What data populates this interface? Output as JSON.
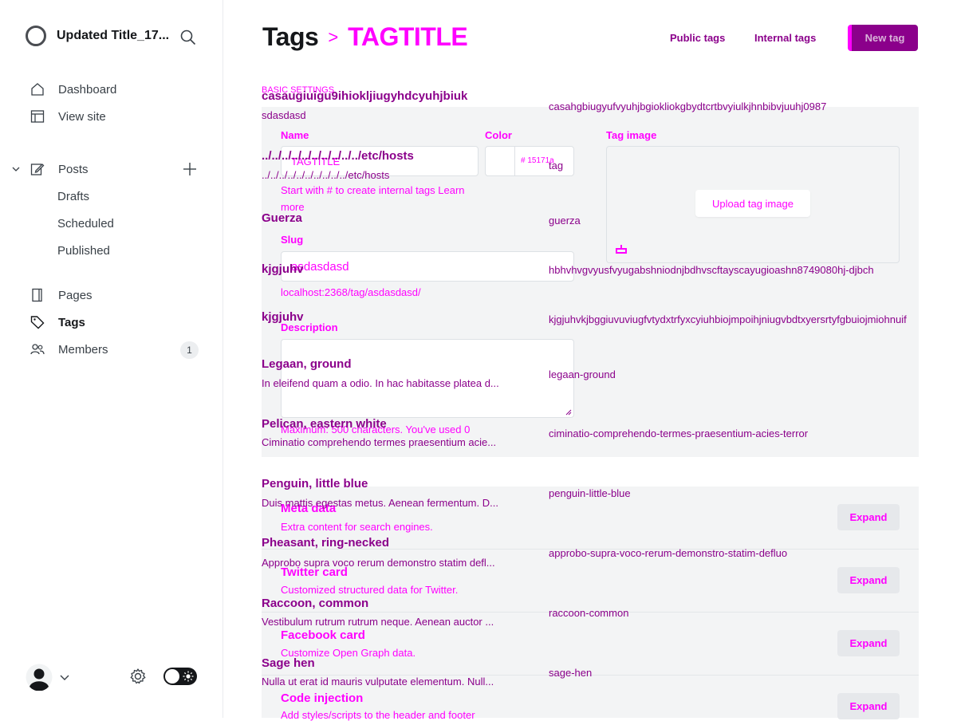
{
  "sidebar": {
    "site_title": "Updated Title_17...",
    "nav": {
      "dashboard": "Dashboard",
      "view_site": "View site",
      "posts": "Posts",
      "drafts": "Drafts",
      "scheduled": "Scheduled",
      "published": "Published",
      "pages": "Pages",
      "tags": "Tags",
      "members": "Members",
      "members_count": "1"
    }
  },
  "header": {
    "breadcrumb_parent": "Tags",
    "breadcrumb_separator": ">",
    "breadcrumb_current": "TAGTITLE",
    "public_tags": "Public tags",
    "internal_tags": "Internal tags",
    "new_tag": "New tag"
  },
  "form": {
    "section_label": "BASIC SETTINGS",
    "name_label": "Name",
    "name_value": "TAGTITLE",
    "name_hint": "Start with # to create internal tags Learn more",
    "color_label": "Color",
    "color_value": "# 15171a",
    "tag_image_label": "Tag image",
    "upload_button": "Upload tag image",
    "slug_label": "Slug",
    "slug_value": "asdasdasd",
    "slug_url": "localhost:2368/tag/asdasdasd/",
    "description_label": "Description",
    "description_hint": "Maximum: 500 characters. You've used 0"
  },
  "expand_sections": [
    {
      "title": "Meta data",
      "subtitle": "Extra content for search engines.",
      "button": "Expand"
    },
    {
      "title": "Twitter card",
      "subtitle": "Customized structured data for Twitter.",
      "button": "Expand"
    },
    {
      "title": "Facebook card",
      "subtitle": "Customize Open Graph data.",
      "button": "Expand"
    },
    {
      "title": "Code injection",
      "subtitle": "Add styles/scripts to the header and footer",
      "button": "Expand"
    }
  ],
  "tag_list": [
    {
      "name": "casaugiuigu9ihiokljiugyhdcyuhjbiuk",
      "desc": "sdasdasd",
      "slug": "casahgbiugyufvyuhjbgiokliokgbydtcrtbvyiulkjhnbibvjuuhj0987"
    },
    {
      "name": "../../../../../../../../../../etc/hosts",
      "desc": "../../../../../../../../../../etc/hosts",
      "slug": "tag"
    },
    {
      "name": "Guerza",
      "desc": "",
      "slug": "guerza"
    },
    {
      "name": "kjgjuhv",
      "desc": "",
      "slug": "hbhvhvgvyusfvyugabshniodnjbdhvscftayscayugioashn8749080hj-djbch"
    },
    {
      "name": "kjgjuhv",
      "desc": "",
      "slug": "kjgjuhvkjbggiuvuviugfvtydxtrfyxcyiuhbiojmpoihjniugvbdtxyersrtyfgbuiojmiohnuif"
    },
    {
      "name": "Legaan, ground",
      "desc": "In eleifend quam a odio. In hac habitasse platea d...",
      "slug": "legaan-ground"
    },
    {
      "name": "Pelican, eastern white",
      "desc": "Ciminatio comprehendo termes praesentium acie...",
      "slug": "ciminatio-comprehendo-termes-praesentium-acies-terror"
    },
    {
      "name": "Penguin, little blue",
      "desc": "Duis mattis egestas metus. Aenean fermentum. D...",
      "slug": "penguin-little-blue"
    },
    {
      "name": "Pheasant, ring-necked",
      "desc": "Approbo supra voco rerum demonstro statim defl...",
      "slug": "approbo-supra-voco-rerum-demonstro-statim-defluo"
    },
    {
      "name": "Raccoon, common",
      "desc": "Vestibulum rutrum rutrum neque. Aenean auctor ...",
      "slug": "raccoon-common"
    },
    {
      "name": "Sage hen",
      "desc": "Nulla ut erat id mauris vulputate elementum. Null...",
      "slug": "sage-hen"
    }
  ],
  "colors": {
    "accent_magenta": "#ff00ff",
    "accent_purple": "#8b008b",
    "panel_bg": "#f3f4f5"
  }
}
